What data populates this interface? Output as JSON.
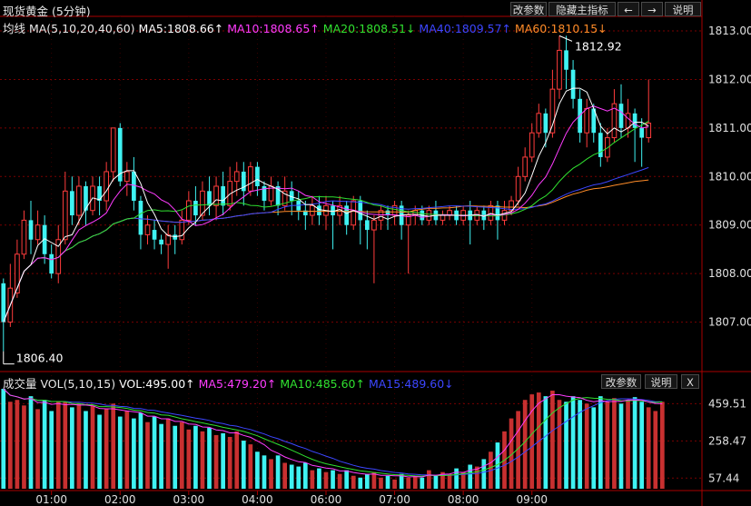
{
  "title": "现货黄金 (5分钟)",
  "top_buttons": {
    "params": "改参数",
    "hide_main": "隐藏主指标",
    "left": "←",
    "right": "→",
    "help": "说明"
  },
  "vol_buttons": {
    "params": "改参数",
    "help": "说明",
    "close": "X"
  },
  "main_legend": {
    "name": "均线 MA(5,10,20,40,60)",
    "ma5": "MA5:1808.66↑",
    "ma10": "MA10:1808.65↑",
    "ma20": "MA20:1808.51↓",
    "ma40": "MA40:1809.57↑",
    "ma60": "MA60:1810.15↓"
  },
  "vol_legend": {
    "name": "成交量 VOL(5,10,15)",
    "vol": "VOL:495.00↑",
    "ma5": "MA5:479.20↑",
    "ma10": "MA10:485.60↑",
    "ma15": "MA15:489.60↓"
  },
  "annotations": {
    "high": "1812.92",
    "low": "1806.40"
  },
  "colors": {
    "up": "#ff3c3c",
    "down": "#3ff2f2",
    "ma5": "#ffffff",
    "ma10": "#ff3cff",
    "ma20": "#30e030",
    "ma40": "#3c46ff",
    "ma60": "#ff8c28",
    "grid": "#7a0000",
    "axis": "#aa0000"
  },
  "chart_data": [
    {
      "type": "candlestick",
      "title": "现货黄金 (5分钟)",
      "y_ticks": [
        "1813.00",
        "1812.00",
        "1811.00",
        "1810.00",
        "1809.00",
        "1808.00",
        "1807.00"
      ],
      "ylim": [
        1806.0,
        1813.3
      ],
      "x_ticks": [
        "01:00",
        "02:00",
        "03:00",
        "04:00",
        "06:00",
        "07:00",
        "08:00",
        "09:00"
      ],
      "x_tick_index": [
        7,
        17,
        27,
        37,
        47,
        57,
        67,
        77
      ],
      "candles": [
        [
          1807.8,
          1807.0,
          1807.9,
          1806.4
        ],
        [
          1807.0,
          1807.7,
          1808.2,
          1806.9
        ],
        [
          1807.6,
          1808.4,
          1808.7,
          1807.5
        ],
        [
          1808.4,
          1809.1,
          1809.3,
          1808.3
        ],
        [
          1809.1,
          1808.7,
          1809.5,
          1808.4
        ],
        [
          1808.7,
          1809.0,
          1809.3,
          1808.6
        ],
        [
          1809.0,
          1808.4,
          1809.2,
          1808.2
        ],
        [
          1808.4,
          1808.0,
          1808.6,
          1807.9
        ],
        [
          1808.0,
          1808.7,
          1809.0,
          1807.8
        ],
        [
          1808.7,
          1809.7,
          1810.1,
          1808.6
        ],
        [
          1809.7,
          1809.2,
          1810.0,
          1809.0
        ],
        [
          1809.2,
          1809.8,
          1810.0,
          1809.0
        ],
        [
          1809.8,
          1809.3,
          1809.9,
          1809.0
        ],
        [
          1809.3,
          1809.8,
          1810.0,
          1809.2
        ],
        [
          1809.8,
          1809.5,
          1810.0,
          1809.2
        ],
        [
          1809.5,
          1810.1,
          1810.3,
          1809.3
        ],
        [
          1810.1,
          1811.0,
          1811.0,
          1809.9
        ],
        [
          1811.0,
          1809.9,
          1811.1,
          1809.8
        ],
        [
          1809.9,
          1810.1,
          1810.3,
          1809.6
        ],
        [
          1810.1,
          1809.5,
          1810.4,
          1809.3
        ],
        [
          1809.5,
          1808.8,
          1809.6,
          1808.5
        ],
        [
          1808.8,
          1809.0,
          1809.2,
          1808.6
        ],
        [
          1808.9,
          1808.7,
          1809.1,
          1808.5
        ],
        [
          1808.7,
          1808.6,
          1808.8,
          1808.4
        ],
        [
          1808.6,
          1808.8,
          1809.0,
          1808.1
        ],
        [
          1808.8,
          1808.7,
          1809.0,
          1808.4
        ],
        [
          1808.7,
          1809.1,
          1809.3,
          1808.6
        ],
        [
          1809.1,
          1809.5,
          1809.7,
          1809.0
        ],
        [
          1809.5,
          1809.2,
          1809.8,
          1809.0
        ],
        [
          1809.2,
          1809.7,
          1809.9,
          1809.1
        ],
        [
          1809.7,
          1809.4,
          1810.0,
          1809.2
        ],
        [
          1809.4,
          1809.8,
          1810.0,
          1809.1
        ],
        [
          1809.8,
          1809.4,
          1810.1,
          1809.2
        ],
        [
          1809.4,
          1809.9,
          1810.2,
          1809.3
        ],
        [
          1809.9,
          1810.1,
          1810.3,
          1809.6
        ],
        [
          1810.1,
          1809.7,
          1810.3,
          1809.4
        ],
        [
          1809.7,
          1810.2,
          1810.3,
          1809.6
        ],
        [
          1810.2,
          1809.8,
          1810.3,
          1809.6
        ],
        [
          1809.8,
          1809.5,
          1809.9,
          1809.3
        ],
        [
          1809.5,
          1809.8,
          1810.0,
          1809.4
        ],
        [
          1809.8,
          1809.4,
          1809.9,
          1809.2
        ],
        [
          1809.4,
          1809.7,
          1810.0,
          1809.3
        ],
        [
          1809.7,
          1809.5,
          1809.9,
          1809.2
        ],
        [
          1809.5,
          1809.3,
          1809.7,
          1809.1
        ],
        [
          1809.3,
          1809.2,
          1809.5,
          1808.9
        ],
        [
          1809.2,
          1809.4,
          1809.6,
          1809.0
        ],
        [
          1809.4,
          1809.2,
          1809.6,
          1809.0
        ],
        [
          1809.2,
          1809.4,
          1809.6,
          1808.9
        ],
        [
          1809.4,
          1809.2,
          1809.5,
          1808.5
        ],
        [
          1809.2,
          1809.4,
          1809.6,
          1809.0
        ],
        [
          1809.4,
          1809.0,
          1809.5,
          1808.8
        ],
        [
          1809.0,
          1809.5,
          1809.6,
          1808.9
        ],
        [
          1809.5,
          1809.1,
          1809.6,
          1808.6
        ],
        [
          1809.1,
          1808.9,
          1809.3,
          1808.5
        ],
        [
          1808.9,
          1809.1,
          1809.2,
          1807.8
        ],
        [
          1809.1,
          1809.3,
          1809.4,
          1808.9
        ],
        [
          1809.3,
          1809.2,
          1809.4,
          1808.9
        ],
        [
          1809.2,
          1809.4,
          1809.5,
          1809.0
        ],
        [
          1809.4,
          1809.0,
          1809.5,
          1808.7
        ],
        [
          1809.0,
          1809.2,
          1809.3,
          1808.0
        ],
        [
          1809.2,
          1809.3,
          1809.4,
          1809.0
        ],
        [
          1809.3,
          1809.1,
          1809.4,
          1809.0
        ],
        [
          1809.1,
          1809.3,
          1809.4,
          1809.0
        ],
        [
          1809.3,
          1809.1,
          1809.5,
          1809.0
        ],
        [
          1809.1,
          1809.2,
          1809.3,
          1809.0
        ],
        [
          1809.2,
          1809.3,
          1809.4,
          1809.1
        ],
        [
          1809.3,
          1809.1,
          1809.4,
          1809.0
        ],
        [
          1809.1,
          1809.3,
          1809.4,
          1809.0
        ],
        [
          1809.3,
          1809.1,
          1809.5,
          1808.6
        ],
        [
          1809.1,
          1809.3,
          1809.4,
          1809.0
        ],
        [
          1809.3,
          1809.1,
          1809.4,
          1808.9
        ],
        [
          1809.1,
          1809.4,
          1809.5,
          1809.0
        ],
        [
          1809.4,
          1809.1,
          1809.5,
          1808.7
        ],
        [
          1809.1,
          1809.3,
          1809.5,
          1809.0
        ],
        [
          1809.3,
          1809.5,
          1809.6,
          1809.2
        ],
        [
          1809.5,
          1810.0,
          1810.2,
          1809.4
        ],
        [
          1810.0,
          1810.4,
          1810.6,
          1809.9
        ],
        [
          1810.4,
          1810.9,
          1811.1,
          1810.3
        ],
        [
          1810.9,
          1811.3,
          1811.5,
          1810.8
        ],
        [
          1811.3,
          1810.9,
          1811.4,
          1810.6
        ],
        [
          1810.9,
          1811.8,
          1812.2,
          1810.8
        ],
        [
          1811.8,
          1812.6,
          1812.9,
          1811.6
        ],
        [
          1812.6,
          1812.2,
          1812.9,
          1811.8
        ],
        [
          1812.2,
          1811.6,
          1812.4,
          1811.4
        ],
        [
          1811.6,
          1810.9,
          1811.8,
          1810.7
        ],
        [
          1810.9,
          1811.4,
          1811.6,
          1810.6
        ],
        [
          1811.4,
          1810.9,
          1811.5,
          1810.7
        ],
        [
          1810.9,
          1810.4,
          1811.1,
          1810.2
        ],
        [
          1810.4,
          1810.8,
          1811.0,
          1810.3
        ],
        [
          1810.8,
          1811.5,
          1811.8,
          1810.7
        ],
        [
          1811.5,
          1811.0,
          1811.9,
          1810.8
        ],
        [
          1811.0,
          1811.3,
          1811.6,
          1810.8
        ],
        [
          1811.3,
          1811.0,
          1811.4,
          1810.3
        ],
        [
          1811.0,
          1810.8,
          1811.2,
          1810.2
        ],
        [
          1810.8,
          1811.1,
          1812.0,
          1810.7
        ]
      ]
    },
    {
      "type": "bar",
      "title": "成交量 VOL(5,10,15)",
      "y_ticks": [
        "459.51",
        "258.47",
        "57.44"
      ],
      "ylim": [
        0,
        540
      ],
      "x_ticks": [
        "01:00",
        "02:00",
        "03:00",
        "04:00",
        "06:00",
        "07:00",
        "08:00",
        "09:00"
      ],
      "values": [
        540,
        470,
        480,
        450,
        500,
        430,
        480,
        420,
        470,
        470,
        440,
        460,
        420,
        450,
        400,
        430,
        460,
        390,
        420,
        380,
        410,
        360,
        390,
        350,
        380,
        340,
        360,
        320,
        340,
        310,
        330,
        290,
        300,
        280,
        310,
        260,
        240,
        200,
        180,
        160,
        180,
        140,
        130,
        120,
        140,
        100,
        110,
        90,
        100,
        80,
        100,
        70,
        60,
        80,
        90,
        60,
        70,
        50,
        80,
        60,
        70,
        60,
        100,
        70,
        90,
        80,
        110,
        90,
        130,
        120,
        160,
        200,
        250,
        310,
        380,
        420,
        480,
        510,
        520,
        500,
        530,
        480,
        470,
        500,
        480,
        460,
        440,
        500,
        470,
        490,
        460,
        480,
        495,
        470,
        440,
        420,
        470
      ]
    }
  ]
}
